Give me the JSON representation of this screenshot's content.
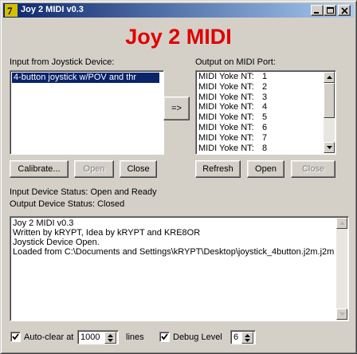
{
  "window": {
    "title": "Joy 2 MIDI v0.3",
    "heading": "Joy 2 MIDI"
  },
  "input_panel": {
    "label": "Input from Joystick Device:",
    "selected_item": "4-button joystick w/POV and thr"
  },
  "transfer_button_label": "=>",
  "output_panel": {
    "label": "Output on MIDI Port:",
    "items": [
      {
        "name": "MIDI Yoke NT:",
        "num": "1"
      },
      {
        "name": "MIDI Yoke NT:",
        "num": "2"
      },
      {
        "name": "MIDI Yoke NT:",
        "num": "3"
      },
      {
        "name": "MIDI Yoke NT:",
        "num": "4"
      },
      {
        "name": "MIDI Yoke NT:",
        "num": "5"
      },
      {
        "name": "MIDI Yoke NT:",
        "num": "6"
      },
      {
        "name": "MIDI Yoke NT:",
        "num": "7"
      },
      {
        "name": "MIDI Yoke NT:",
        "num": "8"
      }
    ]
  },
  "input_buttons": {
    "calibrate": "Calibrate...",
    "open": "Open",
    "close": "Close"
  },
  "output_buttons": {
    "refresh": "Refresh",
    "open": "Open",
    "close": "Close"
  },
  "status": {
    "input": "Input Device Status: Open and Ready",
    "output": "Output Device Status: Closed"
  },
  "log": {
    "lines": [
      "Joy 2 MIDI v0.3",
      "Written by kRYPT, Idea by kRYPT and KRE8OR",
      "Joystick Device Open.",
      "Loaded from C:\\Documents and Settings\\kRYPT\\Desktop\\joystick_4button.j2m.j2m"
    ]
  },
  "bottom": {
    "autoclear_label": "Auto-clear at",
    "autoclear_value": "1000",
    "lines_label": "lines",
    "debug_label": "Debug Level",
    "debug_value": "6",
    "autoclear_checked": true,
    "debug_checked": true
  },
  "colors": {
    "heading": "#e00000",
    "titlebar_start": "#0a246a",
    "titlebar_end": "#a6caf0",
    "selection": "#0a246a",
    "face": "#d4d0c8"
  }
}
